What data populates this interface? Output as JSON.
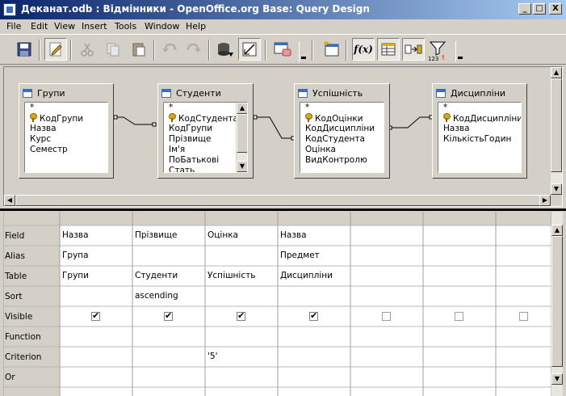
{
  "window": {
    "title": "Деканат.odb : Відмінники - OpenOffice.org Base: Query Design",
    "buttons": {
      "minimize": "_",
      "maximize": "□",
      "close": "X"
    }
  },
  "menu": [
    "File",
    "Edit",
    "View",
    "Insert",
    "Tools",
    "Window",
    "Help"
  ],
  "toolbar": {
    "icons": [
      "save-icon",
      "edit-icon",
      "cut-icon",
      "copy-icon",
      "paste-icon",
      "undo-icon",
      "redo-icon",
      "run-query-icon",
      "design-view-icon",
      "add-table-icon",
      "functions-icon",
      "table-name-icon",
      "alias-icon",
      "distinct-icon",
      "limit-icon"
    ],
    "functions_label": "f(x)",
    "limit_label": "123"
  },
  "tables": [
    {
      "name": "Групи",
      "fields": [
        "*",
        "КодГрупи",
        "Назва",
        "Курс",
        "Семестр"
      ],
      "key_field": 1
    },
    {
      "name": "Студенти",
      "fields": [
        "*",
        "КодСтудента",
        "КодГрупи",
        "Прізвище",
        "Ім'я",
        "ПоБатькові",
        "Стать"
      ],
      "key_field": 1
    },
    {
      "name": "Успішність",
      "fields": [
        "*",
        "КодОцінки",
        "КодДисципліни",
        "КодСтудента",
        "Оцінка",
        "ВидКонтролю"
      ],
      "key_field": 1
    },
    {
      "name": "Дисципліни",
      "fields": [
        "*",
        "КодДисципліни",
        "Назва",
        "КількістьГодин"
      ],
      "key_field": 1
    }
  ],
  "grid": {
    "row_labels": [
      "Field",
      "Alias",
      "Table",
      "Sort",
      "Visible",
      "Function",
      "Criterion",
      "Or"
    ],
    "columns": [
      {
        "field": "Назва",
        "alias": "Група",
        "table": "Групи",
        "sort": "",
        "visible": true,
        "function": "",
        "criterion": ""
      },
      {
        "field": "Прізвище",
        "alias": "",
        "table": "Студенти",
        "sort": "ascending",
        "visible": true,
        "function": "",
        "criterion": ""
      },
      {
        "field": "Оцінка",
        "alias": "",
        "table": "Успішність",
        "sort": "",
        "visible": true,
        "function": "",
        "criterion": "'5'"
      },
      {
        "field": "Назва",
        "alias": "Предмет",
        "table": "Дисципліни",
        "sort": "",
        "visible": true,
        "function": "",
        "criterion": ""
      },
      {
        "field": "",
        "alias": "",
        "table": "",
        "sort": "",
        "visible": false,
        "function": "",
        "criterion": ""
      },
      {
        "field": "",
        "alias": "",
        "table": "",
        "sort": "",
        "visible": false,
        "function": "",
        "criterion": ""
      },
      {
        "field": "",
        "alias": "",
        "table": "",
        "sort": "",
        "visible": false,
        "function": "",
        "criterion": ""
      }
    ]
  }
}
